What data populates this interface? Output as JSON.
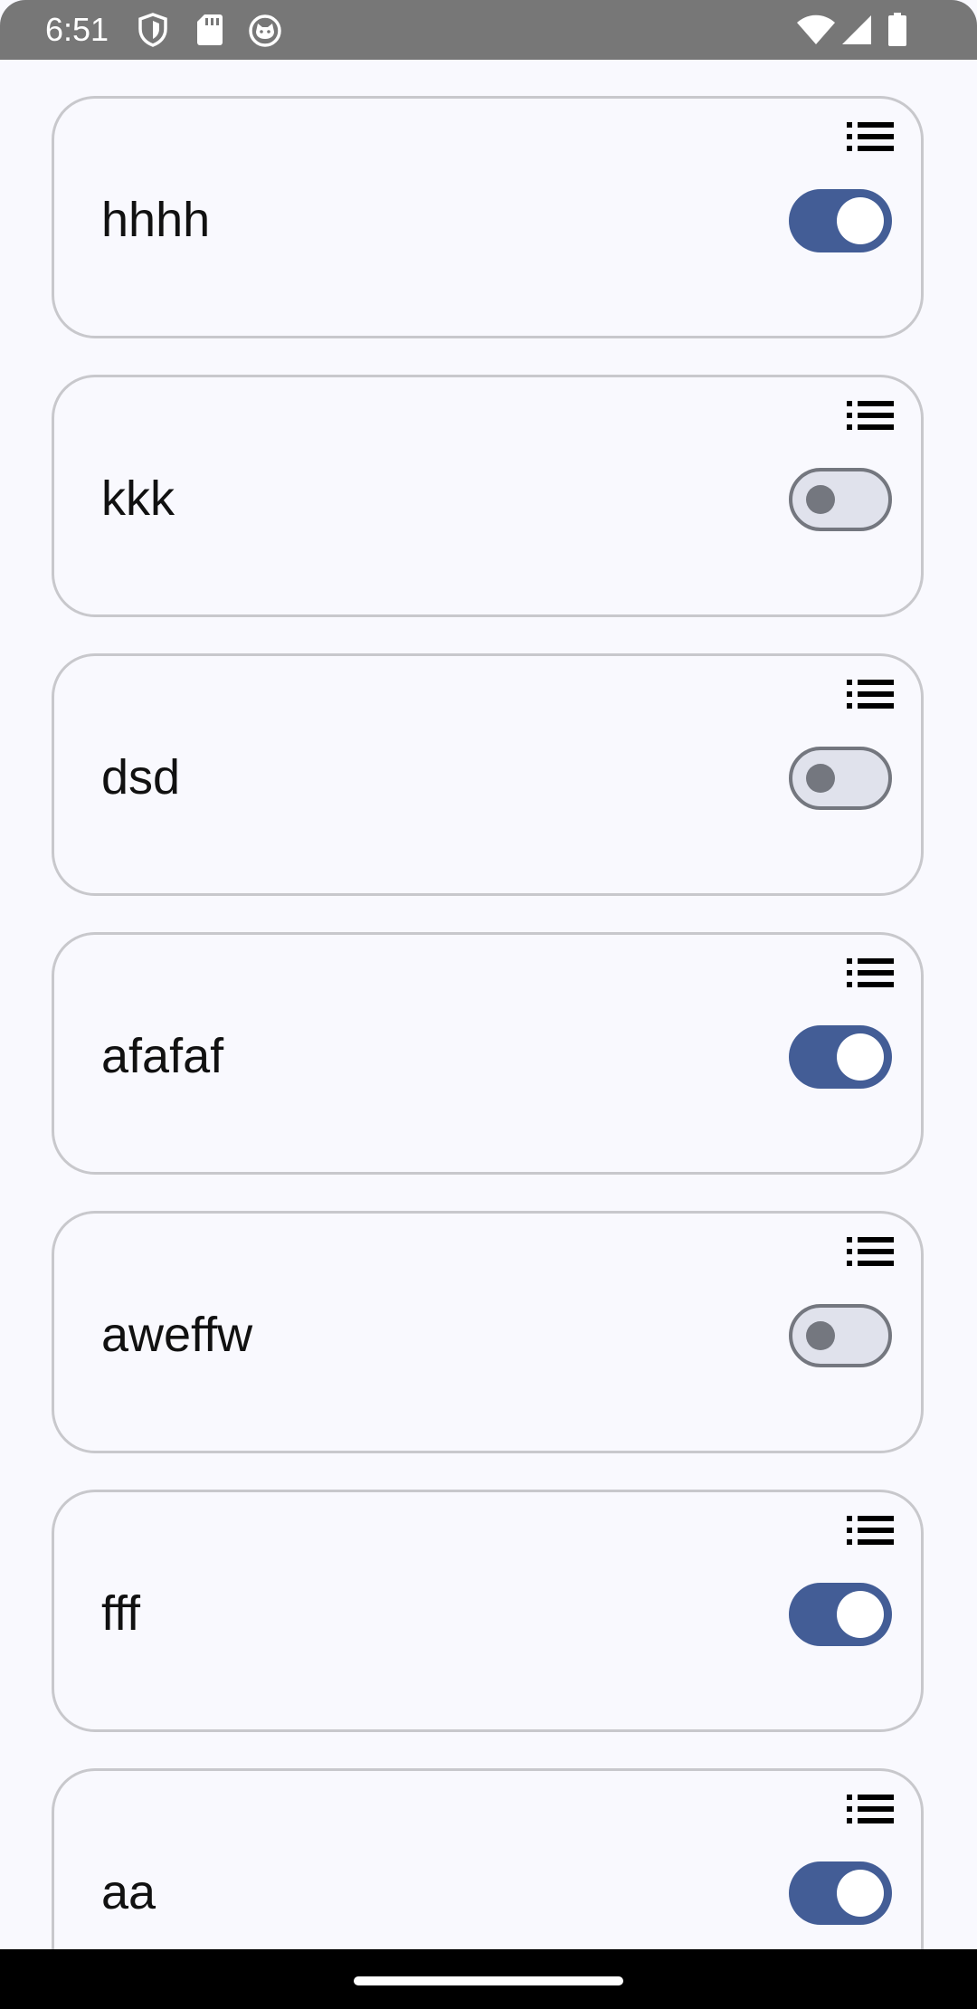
{
  "status_bar": {
    "time": "6:51",
    "left_icons": [
      "shield-icon",
      "sd-card-icon",
      "cat-icon"
    ],
    "right_icons": [
      "wifi-icon",
      "signal-icon",
      "battery-icon"
    ]
  },
  "items": [
    {
      "label": "hhhh",
      "enabled": true
    },
    {
      "label": "kkk",
      "enabled": false
    },
    {
      "label": "dsd",
      "enabled": false
    },
    {
      "label": "afafaf",
      "enabled": true
    },
    {
      "label": "aweffw",
      "enabled": false
    },
    {
      "label": "fff",
      "enabled": true
    },
    {
      "label": "aa",
      "enabled": true
    }
  ],
  "colors": {
    "accent": "#435d96",
    "switch_off_track": "#e0e2ec",
    "switch_off_outline": "#74777f",
    "card_border": "#c8c8cc",
    "background": "#f9f9fe",
    "status_bar": "#777777"
  }
}
